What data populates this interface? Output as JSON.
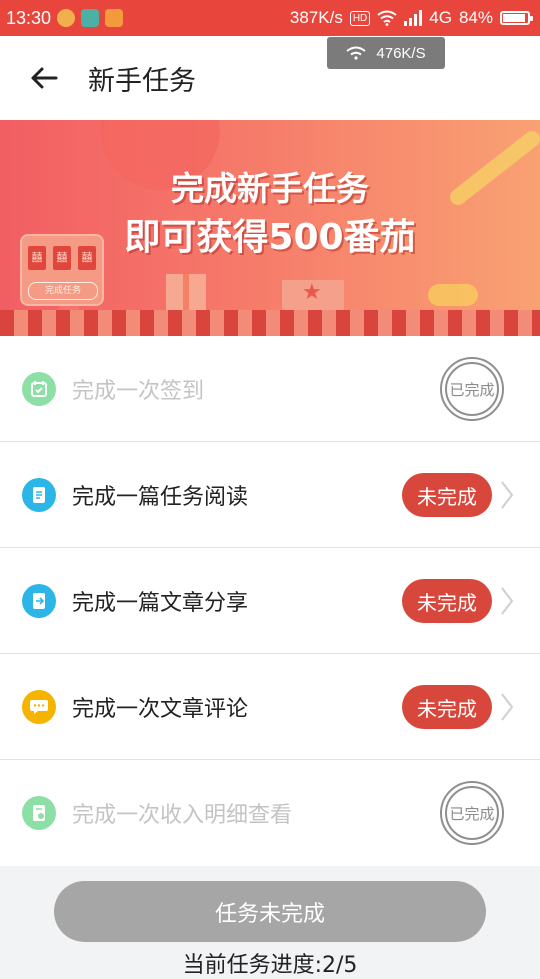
{
  "status_bar": {
    "time": "13:30",
    "speed": "387K/s",
    "hd": "HD",
    "network": "4G",
    "battery": "84%",
    "battery_level": 0.84
  },
  "net_toast": {
    "speed": "476K/S"
  },
  "header": {
    "title": "新手任务"
  },
  "banner": {
    "line1": "完成新手任务",
    "line2": "即可获得500番茄",
    "machine_label": "完成任务",
    "machine_slots": [
      "囍",
      "囍",
      "囍"
    ]
  },
  "tasks": [
    {
      "label": "完成一次签到",
      "status": "已完成",
      "done": true,
      "icon": "calendar-icon",
      "color": "#2fc75f"
    },
    {
      "label": "完成一篇任务阅读",
      "status": "未完成",
      "done": false,
      "icon": "document-icon",
      "color": "#2cb6e8"
    },
    {
      "label": "完成一篇文章分享",
      "status": "未完成",
      "done": false,
      "icon": "share-icon",
      "color": "#2cb6e8"
    },
    {
      "label": "完成一次文章评论",
      "status": "未完成",
      "done": false,
      "icon": "comment-icon",
      "color": "#f5b400"
    },
    {
      "label": "完成一次收入明细查看",
      "status": "已完成",
      "done": true,
      "icon": "income-icon",
      "color": "#2fc75f"
    }
  ],
  "footer": {
    "button": "任务未完成",
    "progress": "当前任务进度:2/5"
  },
  "colors": {
    "accent": "#e8463c",
    "pill": "#d8473c",
    "disabled": "#a6a6a6"
  }
}
